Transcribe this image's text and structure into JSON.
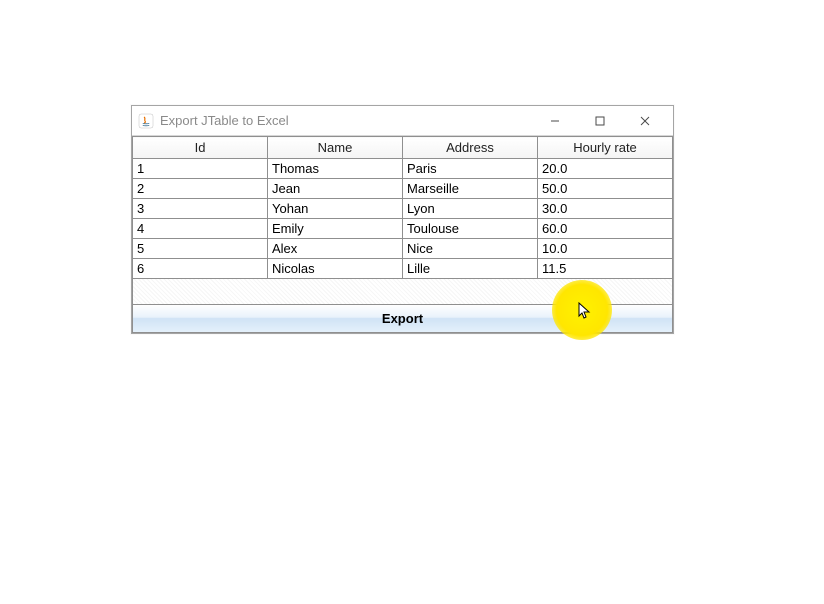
{
  "window": {
    "title": "Export JTable to Excel"
  },
  "table": {
    "headers": [
      "Id",
      "Name",
      "Address",
      "Hourly rate"
    ],
    "rows": [
      {
        "id": "1",
        "name": "Thomas",
        "address": "Paris",
        "rate": "20.0"
      },
      {
        "id": "2",
        "name": "Jean",
        "address": "Marseille",
        "rate": "50.0"
      },
      {
        "id": "3",
        "name": "Yohan",
        "address": "Lyon",
        "rate": "30.0"
      },
      {
        "id": "4",
        "name": "Emily",
        "address": "Toulouse",
        "rate": "60.0"
      },
      {
        "id": "5",
        "name": "Alex",
        "address": "Nice",
        "rate": "10.0"
      },
      {
        "id": "6",
        "name": "Nicolas",
        "address": "Lille",
        "rate": "11.5"
      }
    ]
  },
  "buttons": {
    "export": "Export"
  }
}
